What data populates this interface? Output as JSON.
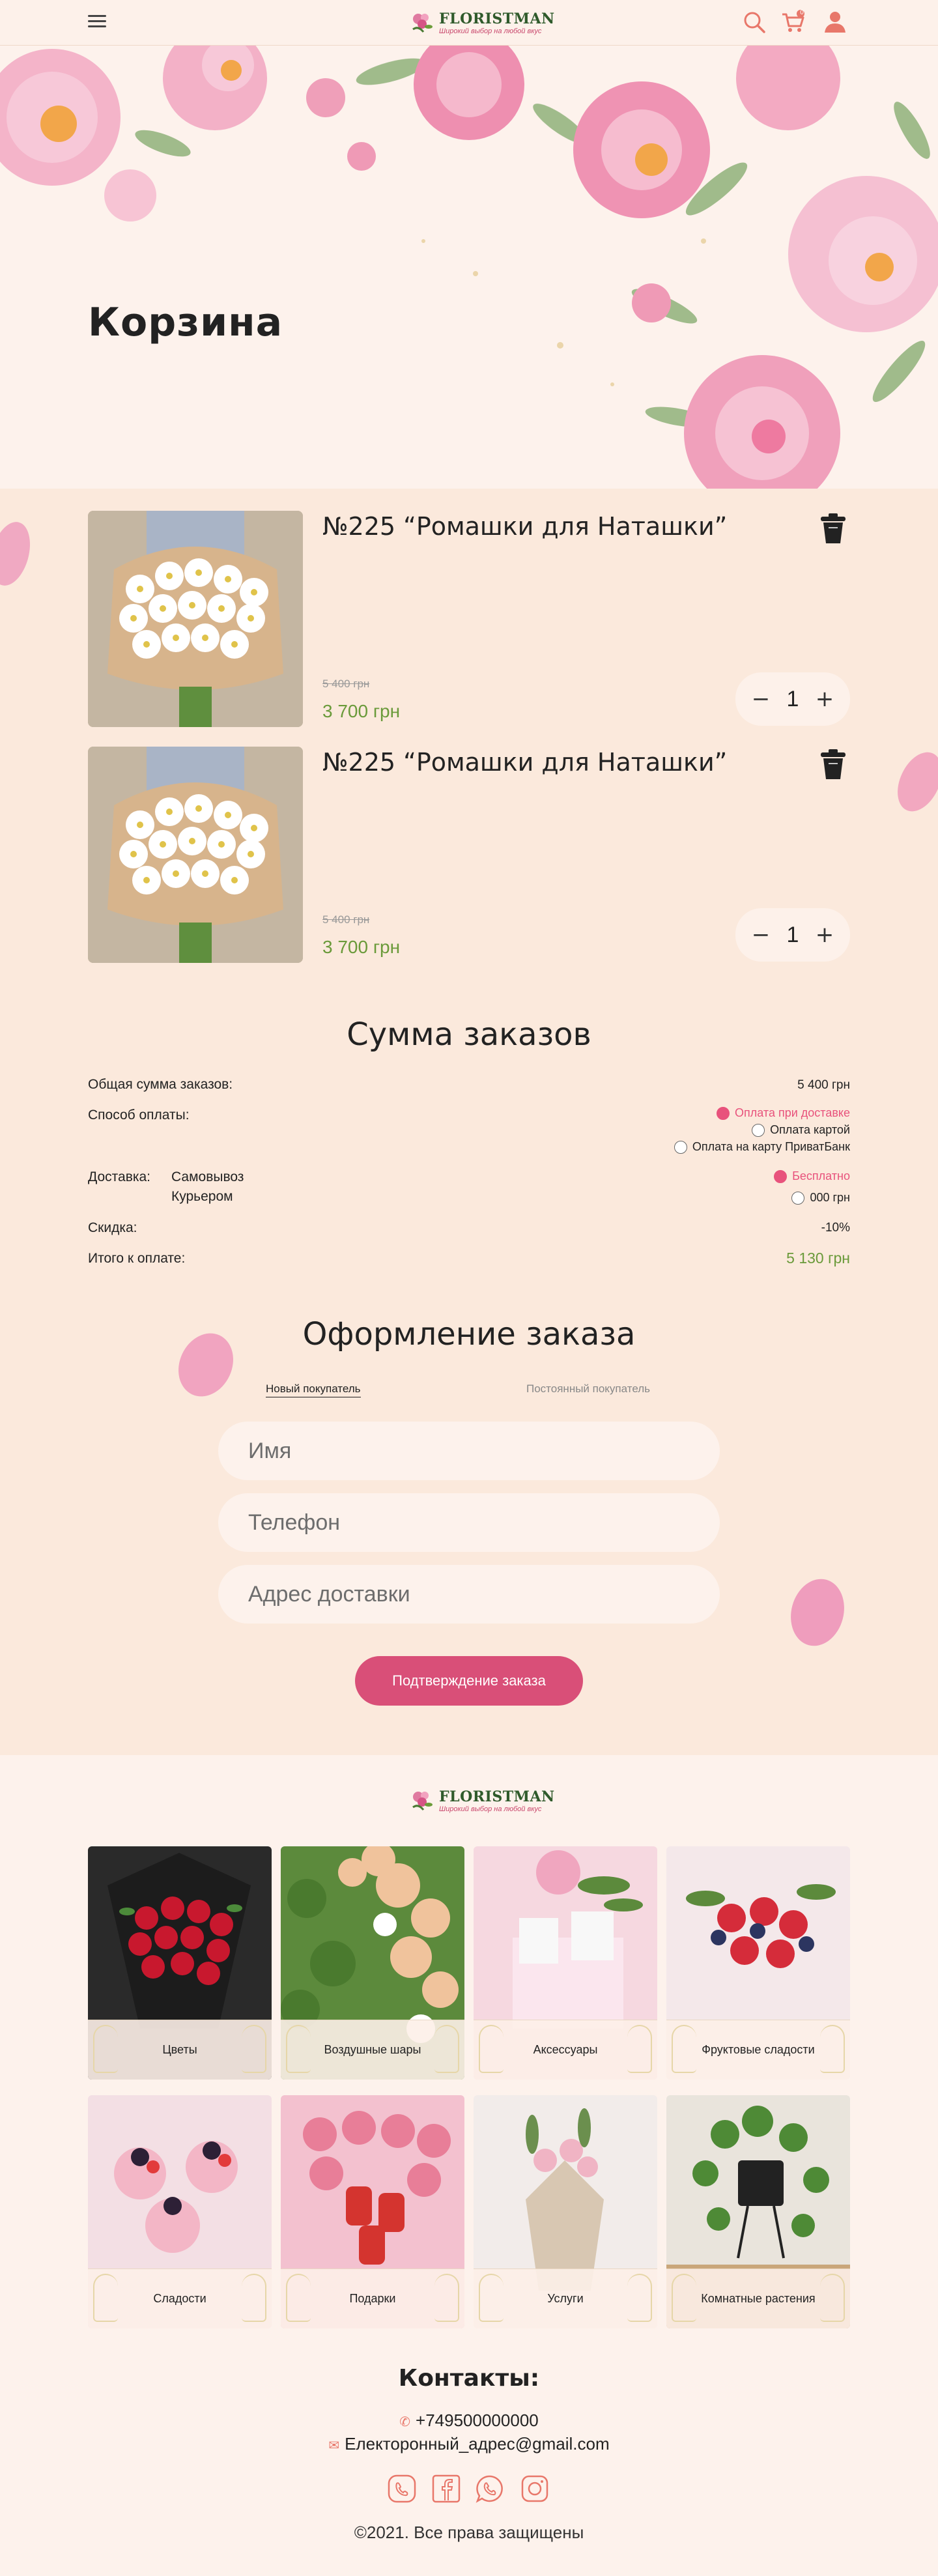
{
  "header": {
    "logo_name": "FLORISTMAN",
    "logo_tagline": "Широкий выбор на любой вкус",
    "cart_count": "0"
  },
  "hero": {
    "title": "Корзина"
  },
  "cart": {
    "items": [
      {
        "title": "№225 “Ромашки для Наташки”",
        "old_price": "5 400 грн",
        "price": "3 700 грн",
        "qty": "1"
      },
      {
        "title": "№225 “Ромашки для Наташки”",
        "old_price": "5 400 грн",
        "price": "3 700 грн",
        "qty": "1"
      }
    ]
  },
  "summary": {
    "title": "Сумма заказов",
    "total_label": "Общая сумма заказов:",
    "total_value": "5 400 грн",
    "payment_label": "Способ оплаты:",
    "payment_options": [
      "Оплата при доставке",
      "Оплата картой",
      "Оплата на карту ПриватБанк"
    ],
    "payment_selected": 0,
    "delivery_label": "Доставка:",
    "delivery_methods": [
      "Самовывоз",
      "Курьером"
    ],
    "delivery_prices": [
      "Бесплатно",
      "000 грн"
    ],
    "discount_label": "Скидка:",
    "discount_value": "-10%",
    "pay_label": "Итого к оплате:",
    "pay_value": "5 130 грн"
  },
  "order": {
    "title": "Оформление заказа",
    "tab_new": "Новый покупатель",
    "tab_regular": "Постоянный покупатель",
    "name_placeholder": "Имя",
    "phone_placeholder": "Телефон",
    "address_placeholder": "Адрес доставки",
    "confirm_label": "Подтверждение заказа"
  },
  "categories": [
    {
      "label": "Цветы"
    },
    {
      "label": "Воздушные шары"
    },
    {
      "label": "Аксессуары"
    },
    {
      "label": "Фруктовые сладости"
    },
    {
      "label": "Сладости"
    },
    {
      "label": "Подарки"
    },
    {
      "label": "Услуги"
    },
    {
      "label": "Комнатные растения"
    }
  ],
  "contacts": {
    "title": "Контакты:",
    "phone": "+749500000000",
    "email": "Електоронный_адрес@gmail.com",
    "copyright": "©2021. Все права защищены"
  },
  "colors": {
    "accent": "#d94f78",
    "price_green": "#6a9a3a",
    "bg_peach": "#fbe9dc",
    "bg_light": "#fdf2ec"
  },
  "icons": [
    "menu-icon",
    "search-icon",
    "cart-icon",
    "user-icon",
    "trash-icon",
    "viber-icon",
    "facebook-icon",
    "whatsapp-icon",
    "instagram-icon"
  ]
}
